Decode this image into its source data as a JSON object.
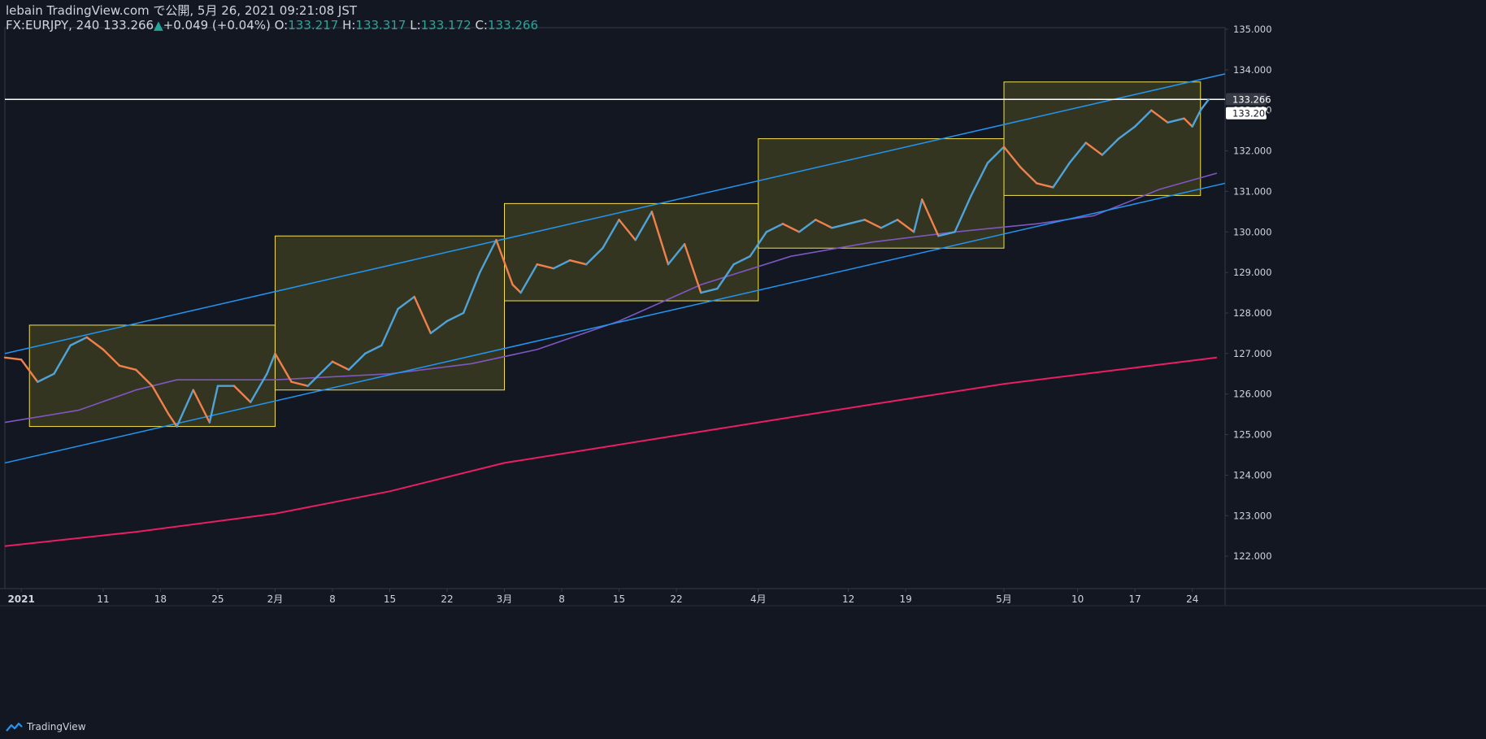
{
  "header": {
    "publish_line": "lebain TradingView.com で公開, 5月 26, 2021 09:21:08 JST",
    "symbol": "FX:EURJPY, 240 133.266",
    "change_arrow": "▲",
    "change": "+0.049 (+0.04%)",
    "o_label": "O:",
    "o_value": "133.217",
    "h_label": "H:",
    "h_value": "133.317",
    "l_label": "L:",
    "l_value": "133.172",
    "c_label": "C:",
    "c_value": "133.266"
  },
  "footer": {
    "brand": "TradingView"
  },
  "colors": {
    "background": "#131722",
    "up": "#4fa3d8",
    "down": "#f0814d",
    "channel": "#2196f3",
    "ma_short": "#7e57c2",
    "ma_long": "#e91e63",
    "box_border": "#f4e04d",
    "box_fill": "#5a5a22",
    "price_line": "#ffffff",
    "text": "#d1d4dc"
  },
  "chart_data": {
    "type": "line",
    "symbol": "FX:EURJPY",
    "timeframe": "240",
    "ylim": [
      121.2,
      135.0
    ],
    "y_ticks": [
      122,
      123,
      124,
      125,
      126,
      127,
      128,
      129,
      130,
      131,
      132,
      133,
      134,
      135
    ],
    "y_tick_labels": [
      "122.000",
      "123.000",
      "124.000",
      "125.000",
      "126.000",
      "127.000",
      "128.000",
      "129.000",
      "130.000",
      "131.000",
      "132.000",
      "133.000",
      "134.000",
      "135.000"
    ],
    "x_range": [
      "2020-12-30",
      "2021-05-28"
    ],
    "x_ticks": [
      {
        "date": "2021-01-01",
        "label": "2021",
        "bold": true
      },
      {
        "date": "2021-01-11",
        "label": "11"
      },
      {
        "date": "2021-01-18",
        "label": "18"
      },
      {
        "date": "2021-01-25",
        "label": "25"
      },
      {
        "date": "2021-02-01",
        "label": "2月"
      },
      {
        "date": "2021-02-08",
        "label": "8"
      },
      {
        "date": "2021-02-15",
        "label": "15"
      },
      {
        "date": "2021-02-22",
        "label": "22"
      },
      {
        "date": "2021-03-01",
        "label": "3月"
      },
      {
        "date": "2021-03-08",
        "label": "8"
      },
      {
        "date": "2021-03-15",
        "label": "15"
      },
      {
        "date": "2021-03-22",
        "label": "22"
      },
      {
        "date": "2021-04-01",
        "label": "4月"
      },
      {
        "date": "2021-04-12",
        "label": "12"
      },
      {
        "date": "2021-04-19",
        "label": "19"
      },
      {
        "date": "2021-05-01",
        "label": "5月"
      },
      {
        "date": "2021-05-10",
        "label": "10"
      },
      {
        "date": "2021-05-17",
        "label": "17"
      },
      {
        "date": "2021-05-24",
        "label": "24"
      }
    ],
    "price_path": [
      [
        "2020-12-30",
        126.9
      ],
      [
        "2021-01-01",
        126.85
      ],
      [
        "2021-01-03",
        126.3
      ],
      [
        "2021-01-05",
        126.5
      ],
      [
        "2021-01-07",
        127.2
      ],
      [
        "2021-01-09",
        127.4
      ],
      [
        "2021-01-11",
        127.1
      ],
      [
        "2021-01-13",
        126.7
      ],
      [
        "2021-01-15",
        126.6
      ],
      [
        "2021-01-17",
        126.2
      ],
      [
        "2021-01-19",
        125.5
      ],
      [
        "2021-01-20",
        125.2
      ],
      [
        "2021-01-22",
        126.1
      ],
      [
        "2021-01-24",
        125.3
      ],
      [
        "2021-01-25",
        126.2
      ],
      [
        "2021-01-27",
        126.2
      ],
      [
        "2021-01-29",
        125.8
      ],
      [
        "2021-01-31",
        126.5
      ],
      [
        "2021-02-01",
        127.0
      ],
      [
        "2021-02-03",
        126.3
      ],
      [
        "2021-02-05",
        126.2
      ],
      [
        "2021-02-08",
        126.8
      ],
      [
        "2021-02-10",
        126.6
      ],
      [
        "2021-02-12",
        127.0
      ],
      [
        "2021-02-14",
        127.2
      ],
      [
        "2021-02-16",
        128.1
      ],
      [
        "2021-02-18",
        128.4
      ],
      [
        "2021-02-20",
        127.5
      ],
      [
        "2021-02-22",
        127.8
      ],
      [
        "2021-02-24",
        128.0
      ],
      [
        "2021-02-26",
        129.0
      ],
      [
        "2021-02-28",
        129.8
      ],
      [
        "2021-03-02",
        128.7
      ],
      [
        "2021-03-03",
        128.5
      ],
      [
        "2021-03-05",
        129.2
      ],
      [
        "2021-03-07",
        129.1
      ],
      [
        "2021-03-09",
        129.3
      ],
      [
        "2021-03-11",
        129.2
      ],
      [
        "2021-03-13",
        129.6
      ],
      [
        "2021-03-15",
        130.3
      ],
      [
        "2021-03-17",
        129.8
      ],
      [
        "2021-03-19",
        130.5
      ],
      [
        "2021-03-21",
        129.2
      ],
      [
        "2021-03-23",
        129.7
      ],
      [
        "2021-03-25",
        128.5
      ],
      [
        "2021-03-27",
        128.6
      ],
      [
        "2021-03-29",
        129.2
      ],
      [
        "2021-03-31",
        129.4
      ],
      [
        "2021-04-02",
        130.0
      ],
      [
        "2021-04-04",
        130.2
      ],
      [
        "2021-04-06",
        130.0
      ],
      [
        "2021-04-08",
        130.3
      ],
      [
        "2021-04-10",
        130.1
      ],
      [
        "2021-04-12",
        130.2
      ],
      [
        "2021-04-14",
        130.3
      ],
      [
        "2021-04-16",
        130.1
      ],
      [
        "2021-04-18",
        130.3
      ],
      [
        "2021-04-20",
        130.0
      ],
      [
        "2021-04-21",
        130.8
      ],
      [
        "2021-04-23",
        129.9
      ],
      [
        "2021-04-25",
        130.0
      ],
      [
        "2021-04-27",
        130.9
      ],
      [
        "2021-04-29",
        131.7
      ],
      [
        "2021-05-01",
        132.1
      ],
      [
        "2021-05-03",
        131.6
      ],
      [
        "2021-05-05",
        131.2
      ],
      [
        "2021-05-07",
        131.1
      ],
      [
        "2021-05-09",
        131.7
      ],
      [
        "2021-05-11",
        132.2
      ],
      [
        "2021-05-13",
        131.9
      ],
      [
        "2021-05-15",
        132.3
      ],
      [
        "2021-05-17",
        132.6
      ],
      [
        "2021-05-19",
        133.0
      ],
      [
        "2021-05-21",
        132.7
      ],
      [
        "2021-05-23",
        132.8
      ],
      [
        "2021-05-24",
        132.6
      ],
      [
        "2021-05-25",
        133.0
      ],
      [
        "2021-05-26",
        133.27
      ]
    ],
    "ma_short": [
      [
        "2020-12-30",
        125.3
      ],
      [
        "2021-01-08",
        125.6
      ],
      [
        "2021-01-15",
        126.1
      ],
      [
        "2021-01-20",
        126.35
      ],
      [
        "2021-02-01",
        126.35
      ],
      [
        "2021-02-15",
        126.5
      ],
      [
        "2021-02-25",
        126.75
      ],
      [
        "2021-03-05",
        127.1
      ],
      [
        "2021-03-15",
        127.8
      ],
      [
        "2021-03-25",
        128.7
      ],
      [
        "2021-04-05",
        129.4
      ],
      [
        "2021-04-15",
        129.75
      ],
      [
        "2021-04-25",
        130.0
      ],
      [
        "2021-05-05",
        130.2
      ],
      [
        "2021-05-12",
        130.4
      ],
      [
        "2021-05-20",
        131.05
      ],
      [
        "2021-05-27",
        131.45
      ]
    ],
    "ma_long": [
      [
        "2020-12-30",
        122.25
      ],
      [
        "2021-01-15",
        122.6
      ],
      [
        "2021-02-01",
        123.05
      ],
      [
        "2021-02-15",
        123.6
      ],
      [
        "2021-03-01",
        124.3
      ],
      [
        "2021-03-15",
        124.75
      ],
      [
        "2021-04-01",
        125.3
      ],
      [
        "2021-04-15",
        125.75
      ],
      [
        "2021-05-01",
        126.25
      ],
      [
        "2021-05-15",
        126.6
      ],
      [
        "2021-05-27",
        126.9
      ]
    ],
    "channel_lines": [
      {
        "from": [
          "2020-12-30",
          127.0
        ],
        "to": [
          "2021-05-28",
          133.9
        ]
      },
      {
        "from": [
          "2020-12-30",
          124.3
        ],
        "to": [
          "2021-05-28",
          131.2
        ]
      }
    ],
    "horizontal_line": 133.27,
    "boxes": [
      {
        "x1": "2021-01-02",
        "x2": "2021-02-01",
        "y1": 125.2,
        "y2": 127.7
      },
      {
        "x1": "2021-02-01",
        "x2": "2021-03-01",
        "y1": 126.1,
        "y2": 129.9
      },
      {
        "x1": "2021-03-01",
        "x2": "2021-04-01",
        "y1": 128.3,
        "y2": 130.7
      },
      {
        "x1": "2021-04-01",
        "x2": "2021-05-01",
        "y1": 129.6,
        "y2": 132.3
      },
      {
        "x1": "2021-05-01",
        "x2": "2021-05-25",
        "y1": 130.9,
        "y2": 133.7
      }
    ],
    "price_labels": [
      {
        "value": 133.266,
        "text": "133.266",
        "style": "dark"
      },
      {
        "value": 133.2,
        "text": "133.200",
        "style": "light"
      }
    ]
  }
}
